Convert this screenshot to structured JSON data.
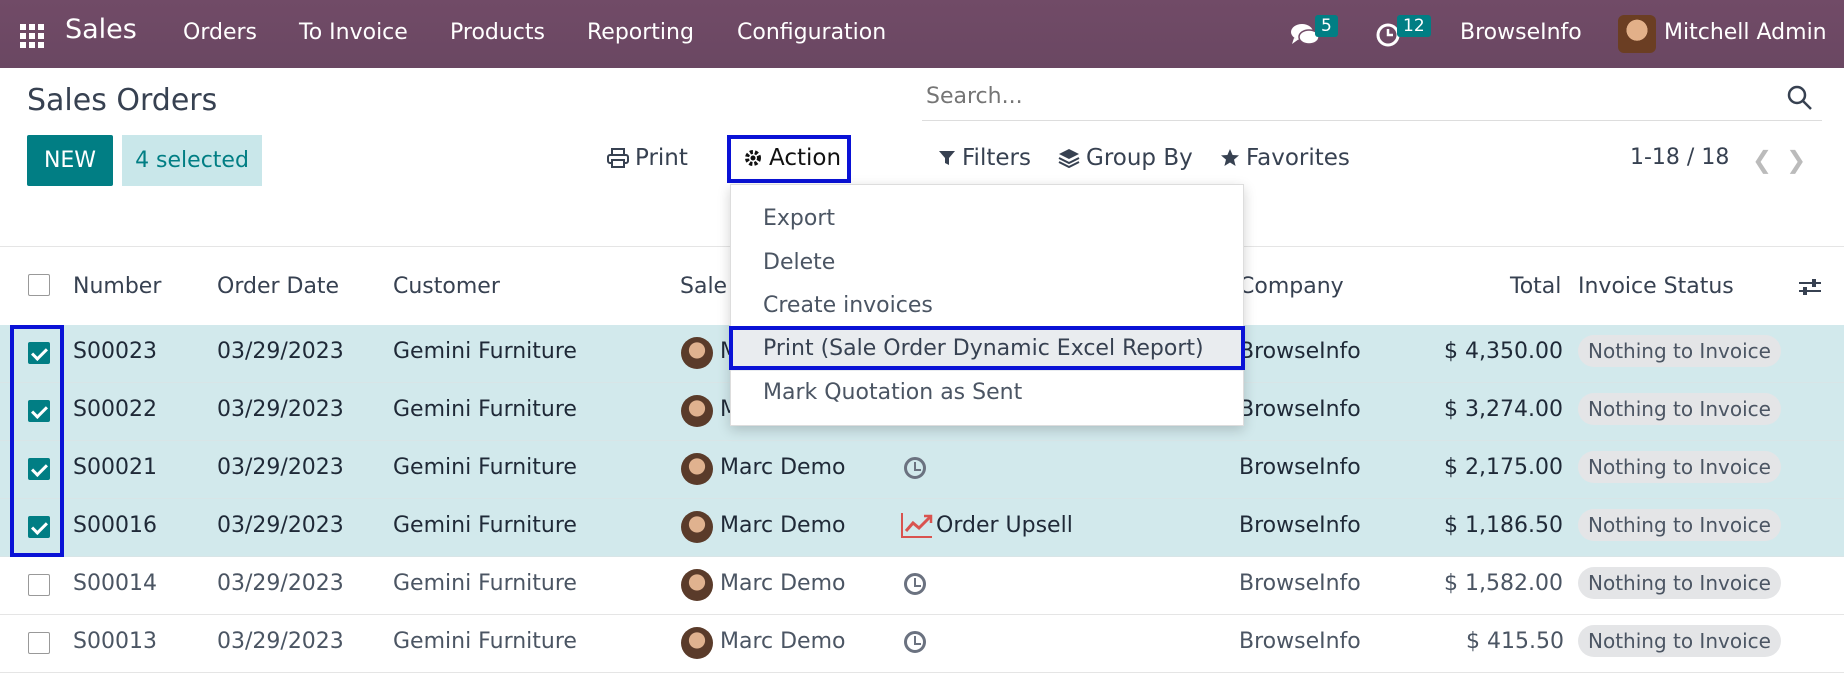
{
  "nav": {
    "app": "Sales",
    "menu": [
      "Orders",
      "To Invoice",
      "Products",
      "Reporting",
      "Configuration"
    ],
    "messages_count": "5",
    "activities_count": "12",
    "company": "BrowseInfo",
    "user": "Mitchell Admin",
    "color": "#714b67"
  },
  "page": {
    "title": "Sales Orders"
  },
  "search": {
    "placeholder": "Search..."
  },
  "toolbar": {
    "new_label": "NEW",
    "selected_label": "4 selected",
    "print_label": "Print",
    "action_label": "Action",
    "filters_label": "Filters",
    "groupby_label": "Group By",
    "favorites_label": "Favorites",
    "pager": "1-18 / 18"
  },
  "action_menu": {
    "items": [
      "Export",
      "Delete",
      "Create invoices",
      "Print (Sale Order Dynamic Excel Report)",
      "Mark Quotation as Sent"
    ],
    "highlighted": "Print (Sale Order Dynamic Excel Report)"
  },
  "table": {
    "columns": [
      "Number",
      "Order Date",
      "Customer",
      "Sale",
      "Company",
      "Total",
      "Invoice Status"
    ],
    "rows": [
      {
        "number": "S00023",
        "date": "03/29/2023",
        "customer": "Gemini Furniture",
        "salesperson": "M",
        "activity": "",
        "company": "BrowseInfo",
        "total": "$ 4,350.00",
        "status": "Nothing to Invoice",
        "selected": true
      },
      {
        "number": "S00022",
        "date": "03/29/2023",
        "customer": "Gemini Furniture",
        "salesperson": "M",
        "activity": "",
        "company": "BrowseInfo",
        "total": "$ 3,274.00",
        "status": "Nothing to Invoice",
        "selected": true
      },
      {
        "number": "S00021",
        "date": "03/29/2023",
        "customer": "Gemini Furniture",
        "salesperson": "Marc Demo",
        "activity": "clock",
        "company": "BrowseInfo",
        "total": "$ 2,175.00",
        "status": "Nothing to Invoice",
        "selected": true
      },
      {
        "number": "S00016",
        "date": "03/29/2023",
        "customer": "Gemini Furniture",
        "salesperson": "Marc Demo",
        "activity": "Order Upsell",
        "company": "BrowseInfo",
        "total": "$ 1,186.50",
        "status": "Nothing to Invoice",
        "selected": true
      },
      {
        "number": "S00014",
        "date": "03/29/2023",
        "customer": "Gemini Furniture",
        "salesperson": "Marc Demo",
        "activity": "clock",
        "company": "BrowseInfo",
        "total": "$ 1,582.00",
        "status": "Nothing to Invoice",
        "selected": false
      },
      {
        "number": "S00013",
        "date": "03/29/2023",
        "customer": "Gemini Furniture",
        "salesperson": "Marc Demo",
        "activity": "clock",
        "company": "BrowseInfo",
        "total": "$ 415.50",
        "status": "Nothing to Invoice",
        "selected": false
      }
    ]
  }
}
